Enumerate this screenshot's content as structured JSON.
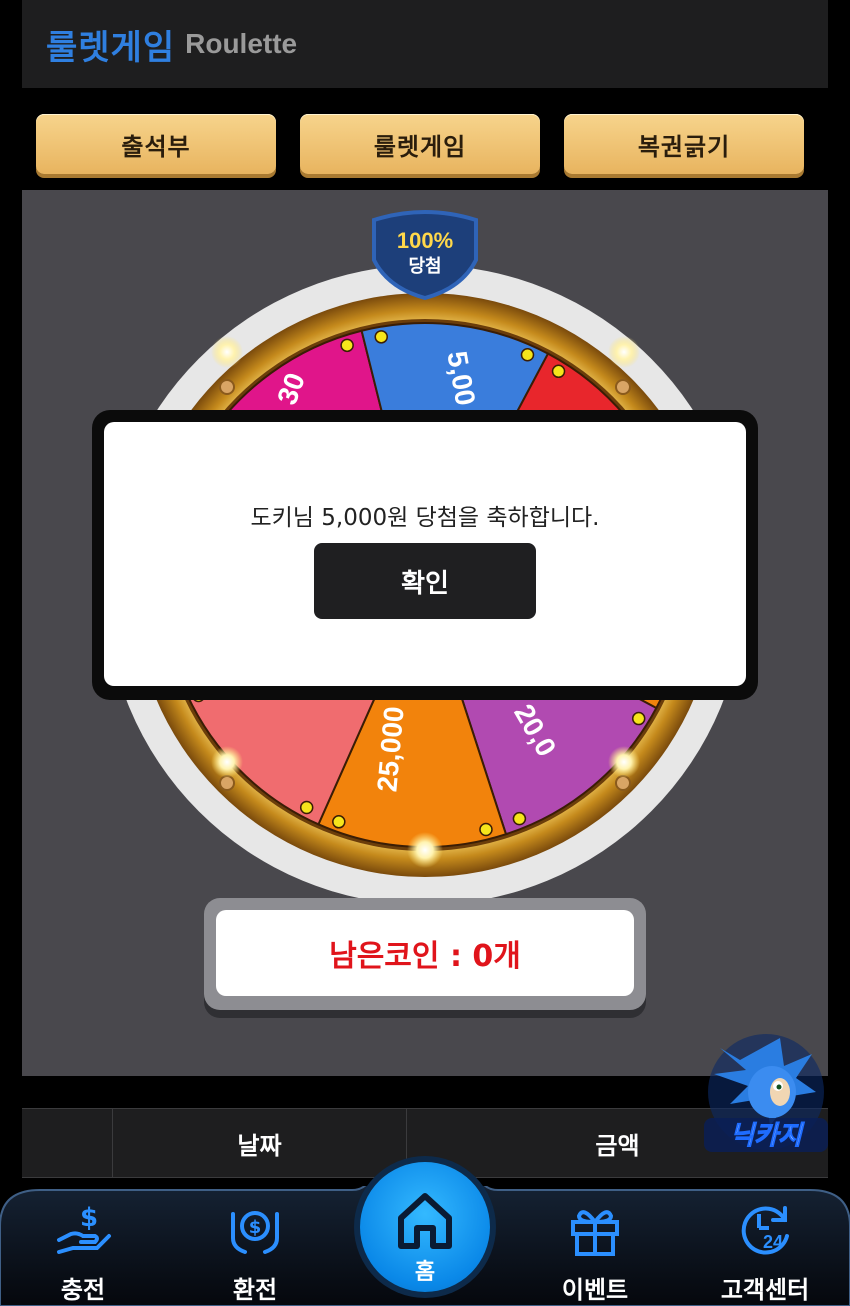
{
  "header": {
    "title_kr": "룰렛게임",
    "title_en": "Roulette"
  },
  "tabs": [
    {
      "label": "출석부"
    },
    {
      "label": "룰렛게임"
    },
    {
      "label": "복권긁기"
    }
  ],
  "wheel": {
    "badge_top": "100%",
    "badge_bottom": "당첨",
    "visible_segment_labels": [
      "30",
      "5,00",
      "25,000",
      "20,0"
    ],
    "colors": {
      "magenta": "#e0158a",
      "blue": "#3a7ddc",
      "red": "#e8262c",
      "salmon": "#f06c6f",
      "orange": "#f2830c",
      "purple": "#b14ab1",
      "gold": "#f2b523"
    }
  },
  "coins": {
    "label": "남은코인 : 0개"
  },
  "modal": {
    "message": "도키님 5,000원 당첨을 축하합니다.",
    "confirm_label": "확인"
  },
  "table": {
    "headers": [
      "날짜",
      "금액"
    ]
  },
  "mascot": {
    "text": "닉카지"
  },
  "nav": {
    "items": [
      {
        "label": "충전",
        "icon": "deposit-hand-icon"
      },
      {
        "label": "환전",
        "icon": "exchange-money-icon"
      },
      {
        "label": "이벤트",
        "icon": "gift-icon"
      },
      {
        "label": "고객센터",
        "icon": "support-24-icon"
      }
    ],
    "home": {
      "label": "홈",
      "icon": "home-icon"
    }
  }
}
